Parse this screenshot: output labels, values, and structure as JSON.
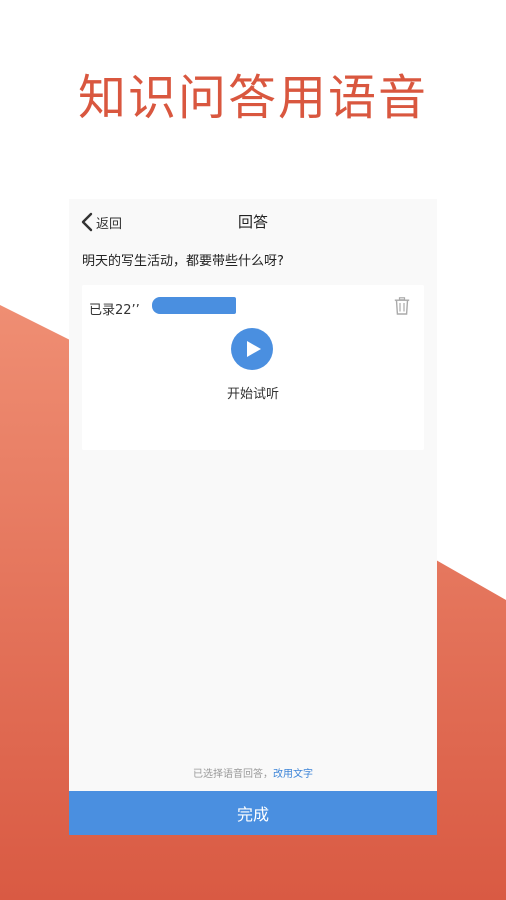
{
  "headline": "知识问答用语音",
  "nav": {
    "back_label": "返回",
    "title": "回答"
  },
  "question": "明天的写生活动，都要带些什么呀?",
  "recording": {
    "label": "已录22’’",
    "preview_label": "开始试听"
  },
  "footer": {
    "note": "已选择语音回答，",
    "switch_label": "改用文字",
    "done_label": "完成"
  },
  "colors": {
    "accent": "#4a8fe0",
    "headline": "#d9573f",
    "background_gradient_top": "#ef8e73",
    "background_gradient_bottom": "#d95a43"
  }
}
